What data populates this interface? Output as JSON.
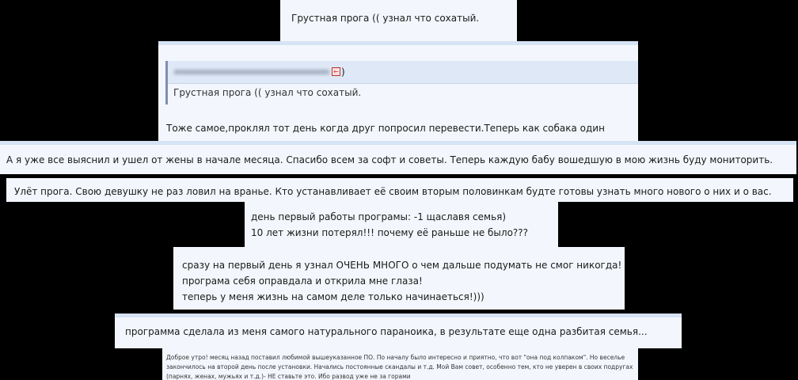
{
  "posts": {
    "p1": {
      "text": "Грустная прога (( узнал что сохатый."
    },
    "p2": {
      "quote_tail": ")",
      "quote_text": "Грустная прога (( узнал что сохатый.",
      "reply": "Тоже самое,проклял тот день когда друг попросил перевести.Теперь как собака один"
    },
    "p3": {
      "text": "А я уже все выяснил и ушел от жены в начале месяца. Спасибо всем за софт и советы. Теперь каждую бабу вошедшую в мою жизнь буду мониторить."
    },
    "p4": {
      "text": "Улёт прога. Свою девушку не раз ловил на вранье. Кто устанавливает её своим вторым половинкам будте готовы узнать много нового о них и о вас."
    },
    "p5": {
      "lines": [
        "день первый работы програмы: -1 щаславя семья)",
        "10 лет жизни потерял!!! почему её раньше не было???"
      ]
    },
    "p6": {
      "lines": [
        "сразу на первый день я узнал ОЧЕНЬ МНОГО о чем дальше подумать не смог никогда!",
        "програма себя оправдала и открила мне глаза!",
        "теперь у меня жизнь на самом деле только начинаеться!)))"
      ]
    },
    "p7": {
      "text": "программа сделала из меня самого натурального параноика, в результате еще одна разбитая семья..."
    },
    "p8": {
      "text": "Доброе утро! месяц назад поставил любимой вышеуказанное ПО. По началу было интересно и приятно, что вот \"она под колпаком\". Но веселье закончилось на второй день после установки. Начались постоянные скандалы и т.д. Мой Вам совет, особенно тем, кто не уверен в своих подругах (парнях, женах, мужьях и т.д.)- НЕ ставьте это. Ибо развод уже не за горами"
    }
  },
  "colors": {
    "background": "#000000",
    "post_bg": "#f3f7fd",
    "quote_head_bg": "#dfe8f6",
    "quote_bar": "#7f8fb0"
  },
  "icons": {
    "quote_back": "back-arrow-icon"
  }
}
